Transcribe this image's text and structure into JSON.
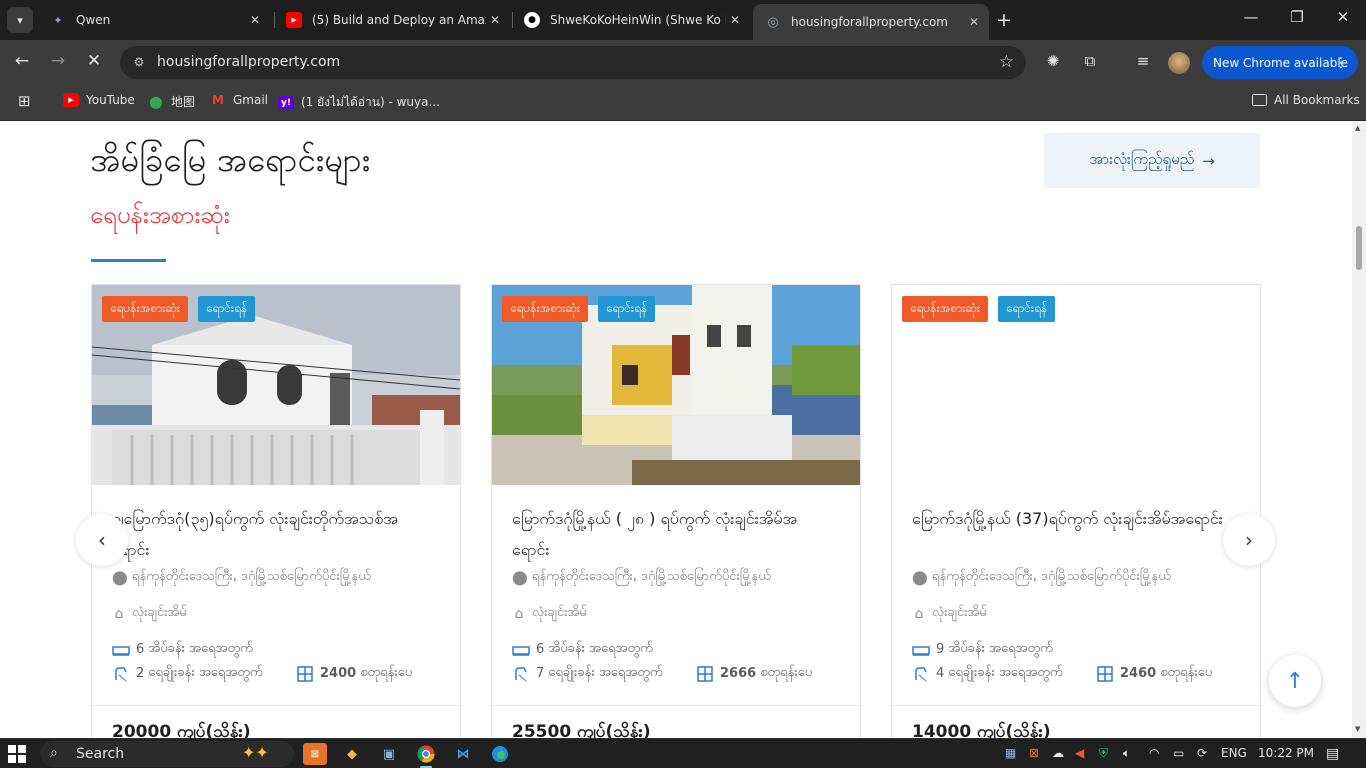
{
  "browser": {
    "tabs": [
      {
        "title": "Qwen",
        "active": false
      },
      {
        "title": "(5) Build and Deploy an Amazin",
        "active": false
      },
      {
        "title": "ShweKoKoHeinWin (Shwe Ko K",
        "active": false
      },
      {
        "title": "housingforallproperty.com",
        "active": true
      }
    ],
    "url": "housingforallproperty.com",
    "new_chrome_label": "New Chrome available",
    "bookmarks": [
      {
        "label": "YouTube"
      },
      {
        "label": "地图"
      },
      {
        "label": "Gmail"
      },
      {
        "label": "(1 ยังไม่ได้อ่าน) - wuya..."
      }
    ],
    "all_bookmarks_label": "All Bookmarks"
  },
  "section": {
    "title": "အိမ်ခြံမြေ အရောင်းများ",
    "subtitle": "ရေပန်းအစားဆုံး",
    "view_all_label": "အားလုံးကြည့်ရှုမည်"
  },
  "listings": [
    {
      "badges": [
        "ရေပန်းအစားဆုံး",
        "ရောင်းရန်"
      ],
      "title": "ချမြောက်ဒဂုံ(၃၅)ရပ်ကွက် လုံးချင်းတိုက်အသစ်အရောင်း",
      "location": "ရန်ကုန်တိုင်းဒေသကြီး, ဒဂုံမြို့သစ်မြောက်ပိုင်းမြို့နယ်",
      "property_type": "လုံးချင်းအိမ်",
      "bedrooms": "6",
      "bedrooms_label": "အိပ်ခန်း အရေအတွက်",
      "bathrooms": "2",
      "bathrooms_label": "ရေချိုးခန်း အရေအတွက်",
      "area": "2400",
      "area_unit": "စတုရန်းပေ",
      "price": "20000 ကျပ်(သိန်း)"
    },
    {
      "badges": [
        "ရေပန်းအစားဆုံး",
        "ရောင်းရန်"
      ],
      "title": "မြောက်ဒဂုံမြို့နယ် ( ၂၈ ) ရပ်ကွက် လုံးချင်းအိမ်အရောင်း",
      "location": "ရန်ကုန်တိုင်းဒေသကြီး, ဒဂုံမြို့သစ်မြောက်ပိုင်းမြို့နယ်",
      "property_type": "လုံးချင်းအိမ်",
      "bedrooms": "6",
      "bedrooms_label": "အိပ်ခန်း အရေအတွက်",
      "bathrooms": "7",
      "bathrooms_label": "ရေချိုးခန်း အရေအတွက်",
      "area": "2666",
      "area_unit": "စတုရန်းပေ",
      "price": "25500 ကျပ်(သိန်း)"
    },
    {
      "badges": [
        "ရေပန်းအစားဆုံး",
        "ရောင်းရန်"
      ],
      "title": "မြောက်ဒဂုံမြို့နယ် (37)ရပ်ကွက် လုံးချင်းအိမ်အရောင်း",
      "location": "ရန်ကုန်တိုင်းဒေသကြီး, ဒဂုံမြို့သစ်မြောက်ပိုင်းမြို့နယ်",
      "property_type": "လုံးချင်းအိမ်",
      "bedrooms": "9",
      "bedrooms_label": "အိပ်ခန်း အရေအတွက်",
      "bathrooms": "4",
      "bathrooms_label": "ရေချိုးခန်း အရေအတွက်",
      "area": "2460",
      "area_unit": "စတုရန်းပေ",
      "price": "14000 ကျပ်(သိန်း)"
    }
  ],
  "taskbar": {
    "search_label": "Search",
    "language": "ENG",
    "time": "10:22 PM"
  },
  "colors": {
    "accent_red": "#e8363f",
    "badge_orange": "#f05a28",
    "badge_blue": "#2196d3",
    "chrome_blue": "#0b57d0"
  }
}
